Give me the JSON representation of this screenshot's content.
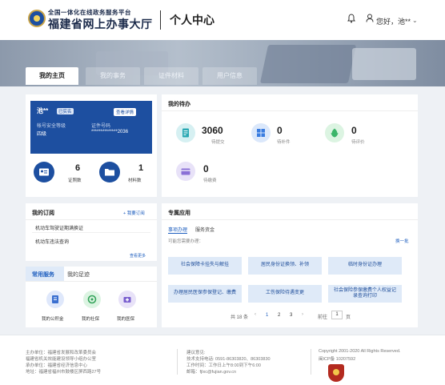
{
  "header": {
    "brand_top": "全国一体化在线政务服务平台",
    "brand_main": "福建省网上办事大厅",
    "title": "个人中心",
    "greeting": "您好，池**"
  },
  "tabs": [
    "我的主页",
    "我的事务",
    "证件材料",
    "用户信息"
  ],
  "account": {
    "name": "池**",
    "verified": "已实名",
    "detail_button": "查看详情",
    "security_label": "帐号安全等级",
    "security_value": "四级",
    "id_label": "证件号码",
    "id_value": "**************2036",
    "stats": [
      {
        "count": "6",
        "label": "证照数"
      },
      {
        "count": "1",
        "label": "材料数"
      }
    ]
  },
  "todo": {
    "title": "我的待办",
    "items": [
      {
        "count": "3060",
        "label": "待提交"
      },
      {
        "count": "0",
        "label": "待补件"
      },
      {
        "count": "0",
        "label": "待评价"
      },
      {
        "count": "0",
        "label": "待缴费"
      }
    ]
  },
  "subscription": {
    "title": "我的订阅",
    "add": "+ 我要订阅",
    "items": [
      "机动车驾驶证期满换证",
      "机动车违法查询"
    ],
    "more": "查看更多"
  },
  "common_services": {
    "tabs": [
      "常用服务",
      "我的足迹"
    ],
    "items": [
      "我的公积金",
      "我的社保",
      "我的医保"
    ]
  },
  "special": {
    "title": "专属应用",
    "tabs": [
      "事项办理",
      "服务资金"
    ],
    "hint": "可能您需要办理：",
    "refresh": "换一批",
    "services": [
      "社会保障卡挂失与解挂",
      "居民身份证换领、补领",
      "临时身份证办理",
      "办理居民医保参保登记、缴费",
      "工伤保险待遇变更",
      "社会保险参保缴费个人权益记录查询打印"
    ],
    "pagination": {
      "total": "共 18 条",
      "pages": [
        "1",
        "2",
        "3"
      ],
      "goto": "前往",
      "page_value": "1",
      "page_unit": "页"
    }
  },
  "footer": {
    "col1": [
      "主办单位：福建省发展和改革委员会",
      "福建省机关效能建设领导小组办公室",
      "承办单位：福建省经济信息中心",
      "地址：福建省福州市鼓楼区屏西路27号"
    ],
    "col2": [
      "建议意见:",
      "技术支持电话: 0591-86303820、86303830",
      "工作时间：工作日上午8:00到下午6:00",
      "邮箱：fjlxc@fujian.gov.cn"
    ],
    "col3": [
      "Copyright 2001-2020 All Rights Reserved.",
      "闽ICP备 10207592"
    ]
  },
  "colors": {
    "blue_card": "#1d4fa0",
    "accent": "#1f5fbf",
    "todo_teal": "#d6f0f2",
    "todo_blue": "#dbe8fb",
    "todo_green": "#dcf4e2",
    "todo_purple": "#e8e2f8"
  }
}
